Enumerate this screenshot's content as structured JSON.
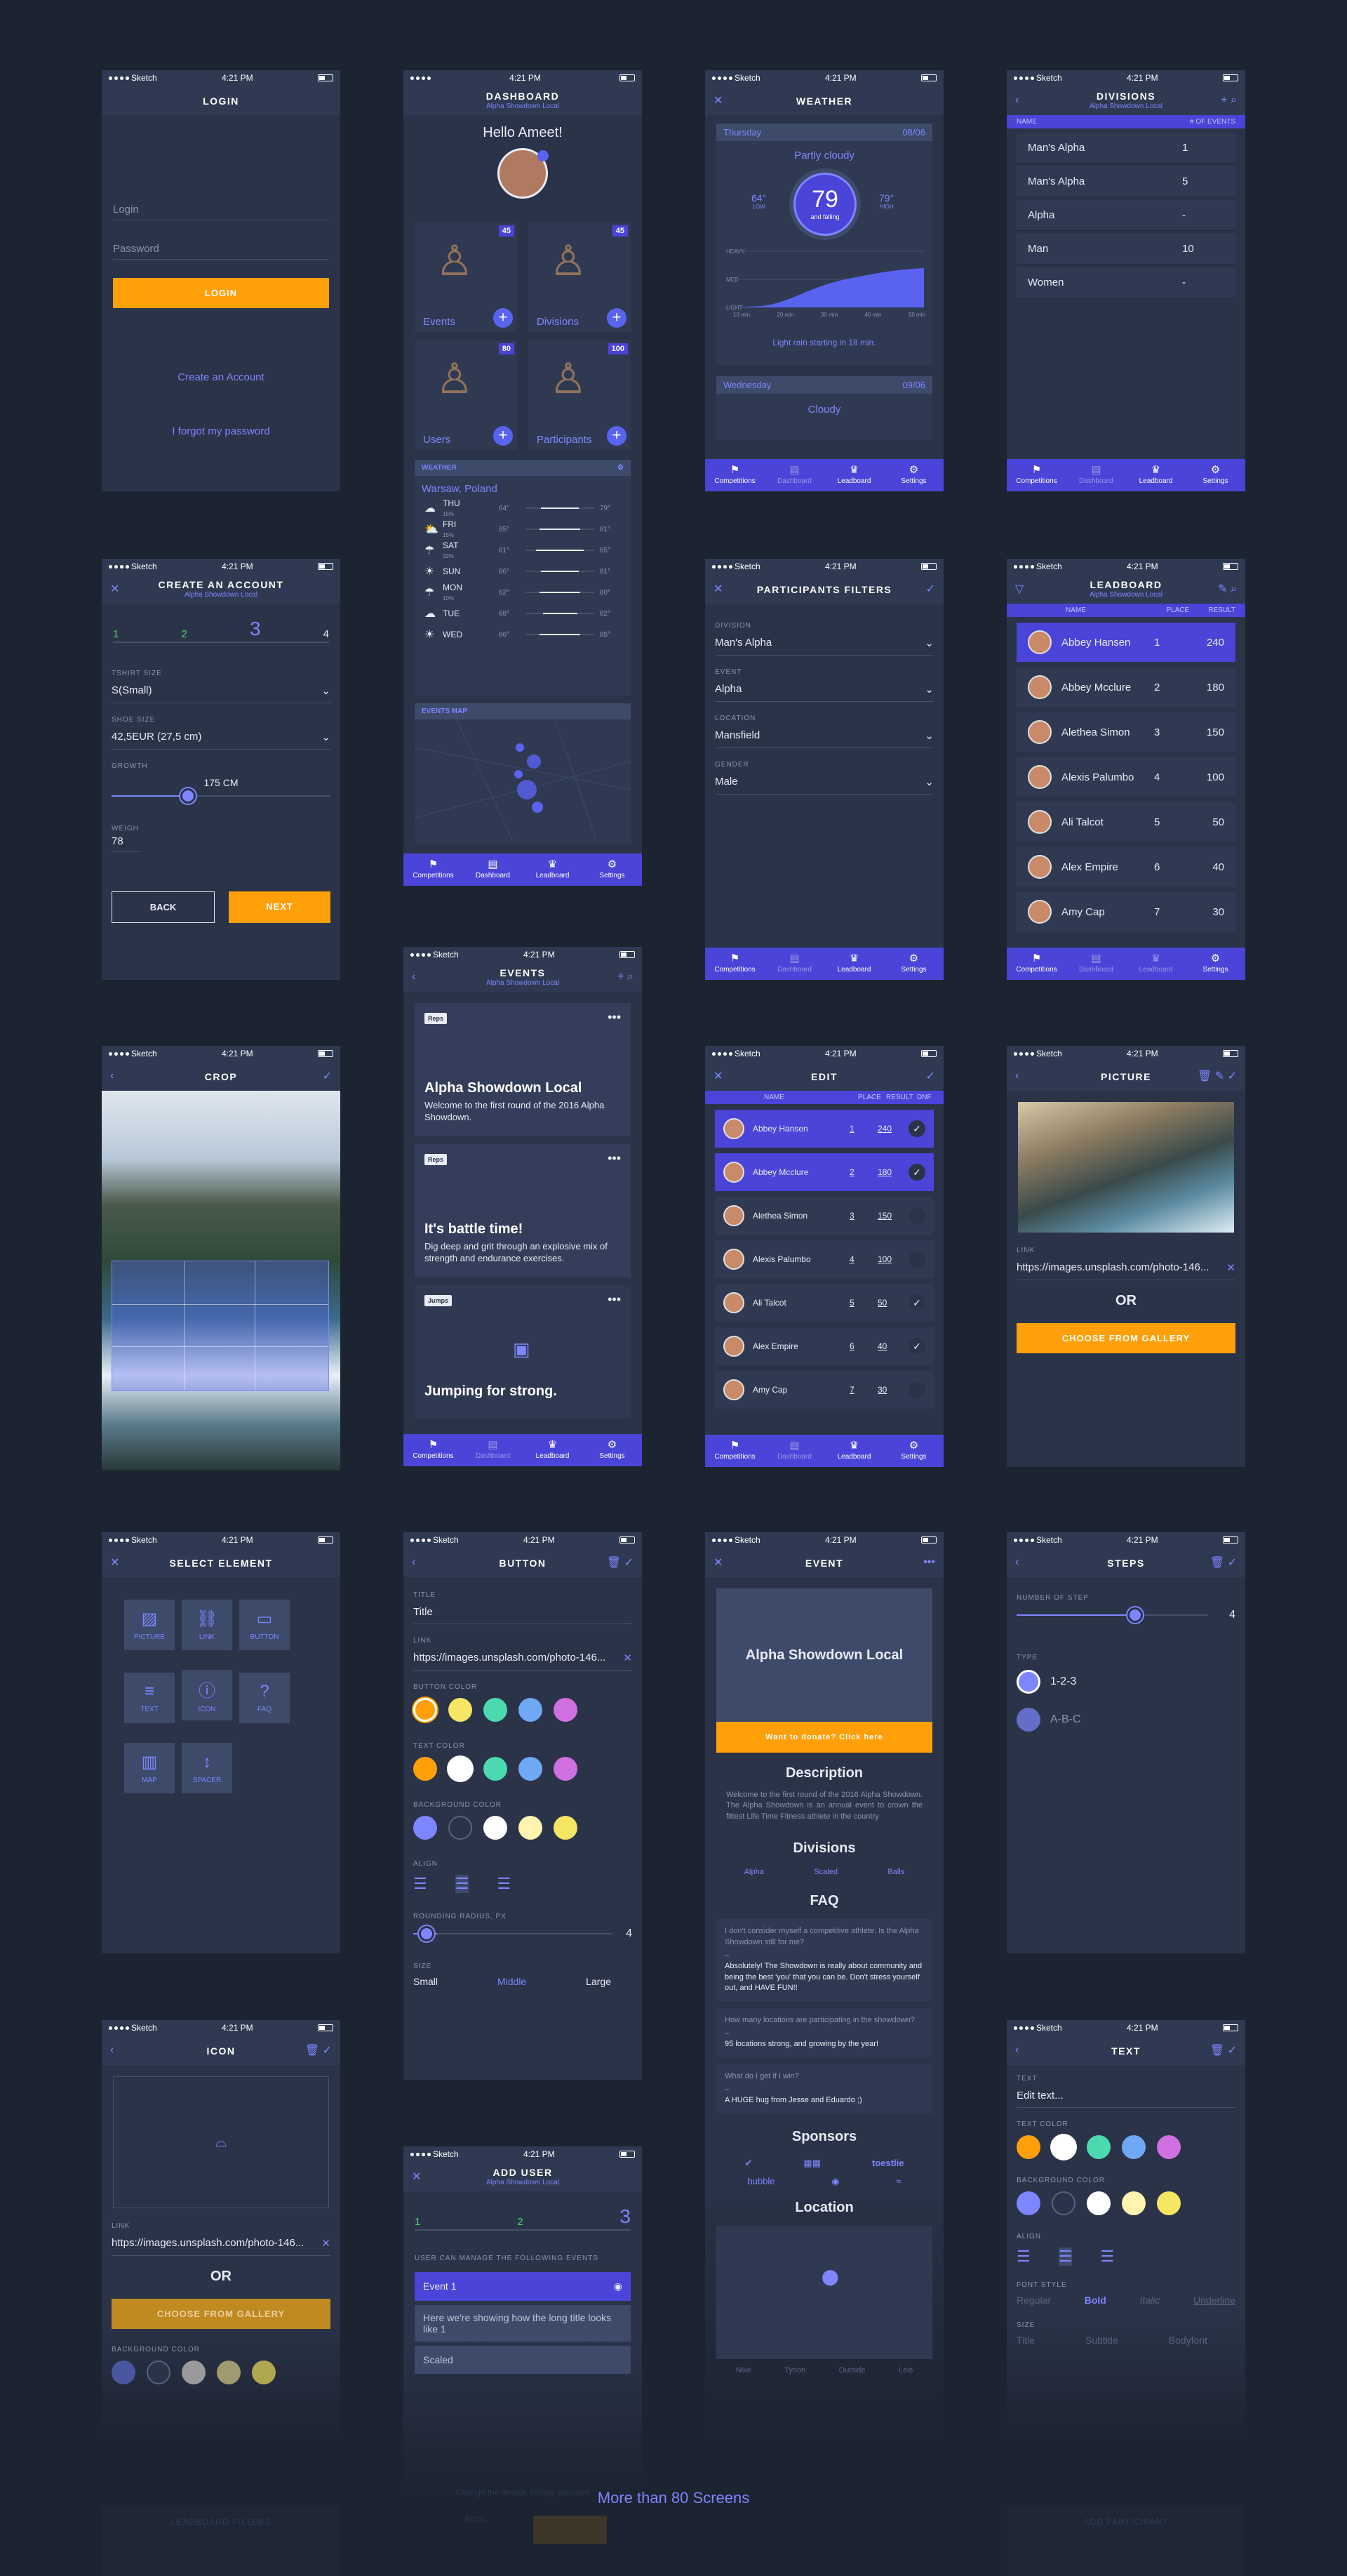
{
  "status": {
    "carrier": "Sketch",
    "time": "4:21 PM"
  },
  "tabbar": {
    "competitions": "Competitions",
    "dashboard": "Dashboard",
    "leadboard": "Leadboard",
    "settings": "Settings"
  },
  "login": {
    "title": "LOGIN",
    "login_placeholder": "Login",
    "password_placeholder": "Password",
    "button": "LOGIN",
    "create": "Create an Account",
    "forgot": "I forgot my password"
  },
  "dashboard": {
    "title": "DASHBOARD",
    "subtitle": "Alpha Showdown Local",
    "greeting": "Hello Ameet!",
    "cards": [
      {
        "label": "Events",
        "count": "45"
      },
      {
        "label": "Divisions",
        "count": "45"
      },
      {
        "label": "Users",
        "count": "80"
      },
      {
        "label": "Participants",
        "count": "100"
      }
    ],
    "weather_header": "WEATHER",
    "city": "Warsaw, Poland",
    "days": [
      {
        "d": "THU",
        "s": "15%",
        "lo": "64°",
        "hi": "79°",
        "f": 0.55
      },
      {
        "d": "FRI",
        "s": "15%",
        "lo": "65°",
        "hi": "81°",
        "f": 0.6
      },
      {
        "d": "SAT",
        "s": "32%",
        "lo": "61°",
        "hi": "85°",
        "f": 0.7
      },
      {
        "d": "SUN",
        "s": "",
        "lo": "66°",
        "hi": "81°",
        "f": 0.55
      },
      {
        "d": "MON",
        "s": "10%",
        "lo": "62°",
        "hi": "80°",
        "f": 0.6
      },
      {
        "d": "TUE",
        "s": "",
        "lo": "68°",
        "hi": "82°",
        "f": 0.5
      },
      {
        "d": "WED",
        "s": "",
        "lo": "66°",
        "hi": "85°",
        "f": 0.6
      }
    ],
    "map_header": "EVENTS MAP"
  },
  "weather": {
    "title": "WEATHER",
    "day1": "Thursday",
    "date1": "08/06",
    "cond1": "Partly cloudy",
    "low": "64°",
    "low_l": "LOW",
    "temp": "79",
    "temp_sub": "and falling",
    "high": "79°",
    "high_l": "HIGH",
    "heavy": "HEAVY",
    "med": "MED",
    "light": "LIGHT",
    "ticks": [
      "10 min",
      "20 min",
      "30 min",
      "40 min",
      "50 min"
    ],
    "note": "Light rain starting in 18 min.",
    "day2": "Wednesday",
    "date2": "09/06",
    "cond2": "Cloudy"
  },
  "divisions": {
    "title": "DIVISIONS",
    "subtitle": "Alpha Showdown Local",
    "col_name": "NAME",
    "col_events": "# OF EVENTS",
    "rows": [
      {
        "n": "Man's Alpha",
        "v": "1"
      },
      {
        "n": "Man's Alpha",
        "v": "5"
      },
      {
        "n": "Alpha",
        "v": "-"
      },
      {
        "n": "Man",
        "v": "10"
      },
      {
        "n": "Women",
        "v": "-"
      }
    ]
  },
  "account": {
    "title": "CREATE AN ACCOUNT",
    "subtitle": "Alpha Showdown Local",
    "steps": [
      "1",
      "2",
      "3",
      "4"
    ],
    "tshirt_l": "TSHIRT SIZE",
    "tshirt": "S(Small)",
    "shoe_l": "SHOE SIZE",
    "shoe": "42,5EUR (27,5 cm)",
    "growth_l": "GROWTH",
    "growth": "175 CM",
    "growth_pct": 0.35,
    "weigh_l": "WEIGH",
    "weigh": "78",
    "back": "BACK",
    "next": "NEXT"
  },
  "filters": {
    "title": "PARTICIPANTS FILTERS",
    "fields": [
      {
        "l": "DIVISION",
        "v": "Man's Alpha"
      },
      {
        "l": "EVENT",
        "v": "Alpha"
      },
      {
        "l": "LOCATION",
        "v": "Mansfield"
      },
      {
        "l": "GENDER",
        "v": "Male"
      }
    ]
  },
  "leadboard": {
    "title": "LEADBOARD",
    "subtitle": "Alpha Showdown Local",
    "col_name": "NAME",
    "col_place": "PLACE",
    "col_result": "RESULT",
    "rows": [
      {
        "n": "Abbey Hansen",
        "p": "1",
        "r": "240"
      },
      {
        "n": "Abbey Mcclure",
        "p": "2",
        "r": "180"
      },
      {
        "n": "Alethea Simon",
        "p": "3",
        "r": "150"
      },
      {
        "n": "Alexis Palumbo",
        "p": "4",
        "r": "100"
      },
      {
        "n": "Ali Talcot",
        "p": "5",
        "r": "50"
      },
      {
        "n": "Alex Empire",
        "p": "6",
        "r": "40"
      },
      {
        "n": "Amy Cap",
        "p": "7",
        "r": "30"
      }
    ]
  },
  "events": {
    "title": "EVENTS",
    "subtitle": "Alpha Showdown Local",
    "items": [
      {
        "tag": "Reps",
        "t": "Alpha Showdown Local",
        "d": "Welcome to the first round of the 2016 Alpha Showdown."
      },
      {
        "tag": "Reps",
        "t": "It's battle time!",
        "d": "Dig deep and grit through an explosive mix of strength and endurance exercises."
      },
      {
        "tag": "Jumps",
        "t": "Jumping for strong.",
        "d": ""
      }
    ]
  },
  "crop": {
    "title": "CROP"
  },
  "edit": {
    "title": "EDIT",
    "col_name": "NAME",
    "col_place": "PLACE",
    "col_result": "RESULT",
    "col_dnf": "DNF",
    "rows": [
      {
        "n": "Abbey Hansen",
        "p": "1",
        "r": "240",
        "c": true,
        "s": true
      },
      {
        "n": "Abbey Mcclure",
        "p": "2",
        "r": "180",
        "c": true,
        "s": true
      },
      {
        "n": "Alethea Simon",
        "p": "3",
        "r": "150",
        "c": false,
        "s": false
      },
      {
        "n": "Alexis Palumbo",
        "p": "4",
        "r": "100",
        "c": false,
        "s": false
      },
      {
        "n": "Ali Talcot",
        "p": "5",
        "r": "50",
        "c": true,
        "s": false
      },
      {
        "n": "Alex Empire",
        "p": "6",
        "r": "40",
        "c": true,
        "s": false
      },
      {
        "n": "Amy Cap",
        "p": "7",
        "r": "30",
        "c": false,
        "s": false
      }
    ]
  },
  "picture": {
    "title": "PICTURE",
    "link_l": "LINK",
    "link": "https://images.unsplash.com/photo-146...",
    "or": "OR",
    "button": "CHOOSE FROM GALLERY"
  },
  "select": {
    "title": "SELECT ELEMENT",
    "items": [
      "PICTURE",
      "LINK",
      "BUTTON",
      "TEXT",
      "ICON",
      "FAQ",
      "MAP",
      "SPACER"
    ]
  },
  "button": {
    "title": "BUTTON",
    "title_l": "TITLE",
    "title_v": "Title",
    "link_l": "LINK",
    "link": "https://images.unsplash.com/photo-146...",
    "bc_l": "BUTTON COLOR",
    "tc_l": "TEXT COLOR",
    "bg_l": "BACKGROUND COLOR",
    "align_l": "ALIGN",
    "radius_l": "ROUNDING RADIUS, PX",
    "radius": "4",
    "size_l": "SIZE",
    "sizes": [
      "Small",
      "Middle",
      "Large"
    ]
  },
  "colors": {
    "c1": [
      "#ff9f0a",
      "#f5e663",
      "#4cd9b0",
      "#6fa8f5",
      "#d070e0"
    ],
    "c2": [
      "#ff9f0a",
      "#ffffff",
      "#4cd9b0",
      "#6fa8f5",
      "#d070e0"
    ],
    "c3": [
      "#7e86ff",
      "#2a3348",
      "#ffffff",
      "#fff3b0",
      "#f5e663"
    ]
  },
  "event": {
    "title": "EVENT",
    "hero": "Alpha Showdown Local",
    "donate": "Want to donate? Click here",
    "desc_h": "Description",
    "desc": "Welcome to the first round of the 2016 Alpha Showdown. The Alpha Showdown is an annual event to crown the fittest Life Time Fitness athlete in the country",
    "div_h": "Divisions",
    "divs": [
      "Alpha",
      "Scaled",
      "Balls"
    ],
    "faq_h": "FAQ",
    "faqs": [
      {
        "q": "I don't consider myself a competitive athlete. Is the Alpha Showdown still for me?",
        "a": "Absolutely! The Showdown is really about community and being the best 'you' that you can be. Don't stress yourself out, and HAVE FUN!!"
      },
      {
        "q": "How many locations are participating in the showdown?",
        "a": "95 locations strong, and growing by the year!"
      },
      {
        "q": "What do I get if I win?",
        "a": "A HUGE hug from Jesse and Eduardo ;)"
      }
    ],
    "spons_h": "Sponsors",
    "loc_h": "Location",
    "bottom": [
      "Nike",
      "Tyrion",
      "Outside",
      "Leis"
    ]
  },
  "steps": {
    "title": "STEPS",
    "num_l": "NUMBER OF STEP",
    "num": "4",
    "num_pct": 0.62,
    "type_l": "TYPE",
    "types": [
      "1-2-3",
      "A-B-C"
    ]
  },
  "icon": {
    "title": "ICON",
    "link_l": "LINK",
    "link": "https://images.unsplash.com/photo-146...",
    "or": "OR",
    "button": "CHOOSE FROM GALLERY",
    "bg_l": "BACKGROUND COLOR",
    "bgc": [
      "#4a56a0",
      "#2a3348",
      "#9a9a9a",
      "#a09a70",
      "#b0a850"
    ]
  },
  "adduser": {
    "title": "ADD USER",
    "subtitle": "Alpha Showdown Local",
    "steps": [
      "1",
      "2",
      "3"
    ],
    "label": "USER CAN MANAGE THE FOLLOWING EVENTS",
    "items": [
      "Event 1",
      "Here we're showing how the long title looks like 1",
      "Scaled"
    ]
  },
  "text": {
    "title": "TEXT",
    "text_l": "TEXT",
    "text_v": "Edit text...",
    "tc_l": "TEXT COLOR",
    "bg_l": "BACKGROUND COLOR",
    "align_l": "ALIGN",
    "fs_l": "FONT STYLE",
    "fs": [
      "Regular",
      "Bold",
      "Italic",
      "Underline"
    ],
    "size_l": "SIZE",
    "sizes": [
      "Title",
      "Subtitle",
      "Bodyfont"
    ]
  },
  "footer": {
    "more": "More than 80 Screens",
    "ghost1": "LEADBOARD FILTERS",
    "ghost2": "Change the default folding selection",
    "ghost3": "ADD PARTICIPANT",
    "ghost4": "BACK"
  }
}
